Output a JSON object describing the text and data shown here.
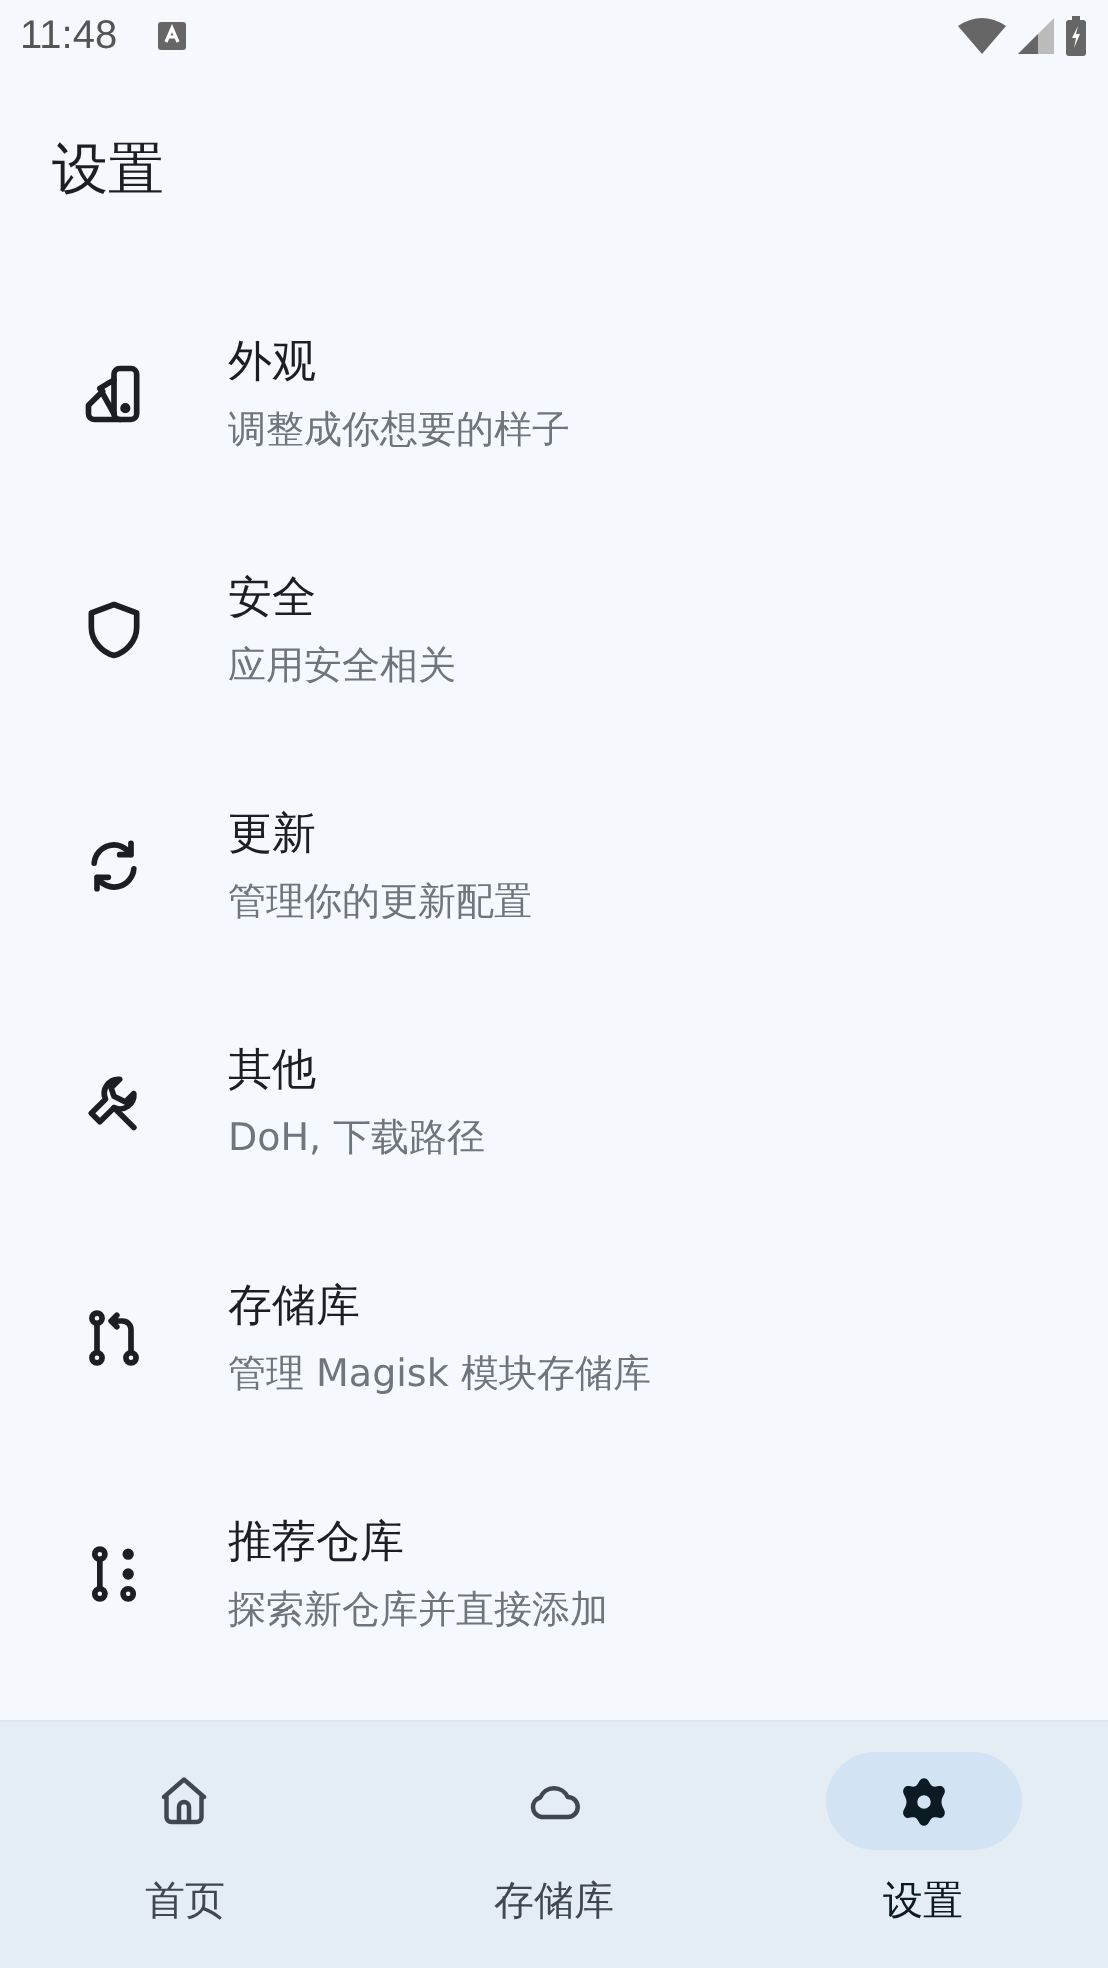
{
  "status_bar": {
    "time": "11:48"
  },
  "title": "设置",
  "items": [
    {
      "kind": "appearance",
      "title": "外观",
      "subtitle": "调整成你想要的样子"
    },
    {
      "kind": "security",
      "title": "安全",
      "subtitle": "应用安全相关"
    },
    {
      "kind": "update",
      "title": "更新",
      "subtitle": "管理你的更新配置"
    },
    {
      "kind": "other",
      "title": "其他",
      "subtitle": "DoH, 下载路径"
    },
    {
      "kind": "repository",
      "title": "存储库",
      "subtitle": "管理 Magisk 模块存储库"
    },
    {
      "kind": "recommended",
      "title": "推荐仓库",
      "subtitle": "探索新仓库并直接添加"
    }
  ],
  "nav": [
    {
      "kind": "home",
      "label": "首页",
      "selected": false
    },
    {
      "kind": "repository",
      "label": "存储库",
      "selected": false
    },
    {
      "kind": "settings",
      "label": "设置",
      "selected": true
    }
  ]
}
